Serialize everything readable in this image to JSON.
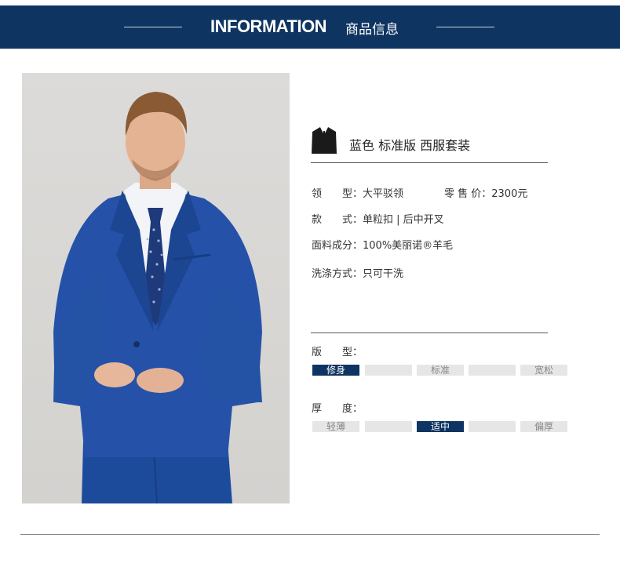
{
  "banner": {
    "title_en": "INFORMATION",
    "title_cn": "商品信息",
    "bg_color": "#0e3461"
  },
  "product": {
    "name": "蓝色 标准版 西服套装",
    "icon": "suit-jacket-icon"
  },
  "specs": {
    "collar_label": "领　　型：",
    "collar_value": "大平驳领",
    "price_label": "零 售 价：",
    "price_value": "2300元",
    "style_label": "款　　式：",
    "style_value": "单粒扣 | 后中开叉",
    "fabric_label": "面料成分：",
    "fabric_value": "100%美丽诺®羊毛",
    "wash_label": "洗涤方式：",
    "wash_value": "只可干洗"
  },
  "fit": {
    "label": "版　　型：",
    "cells": [
      "修身",
      "",
      "标准",
      "",
      "宽松"
    ],
    "selected_index": 0
  },
  "thickness": {
    "label": "厚　　度：",
    "cells": [
      "轻薄",
      "",
      "适中",
      "",
      "偏厚"
    ],
    "selected_index": 2
  },
  "colors": {
    "accent": "#0e3461",
    "inactive_cell": "#e6e6e6",
    "suit_blue": "#1f4fa3"
  }
}
